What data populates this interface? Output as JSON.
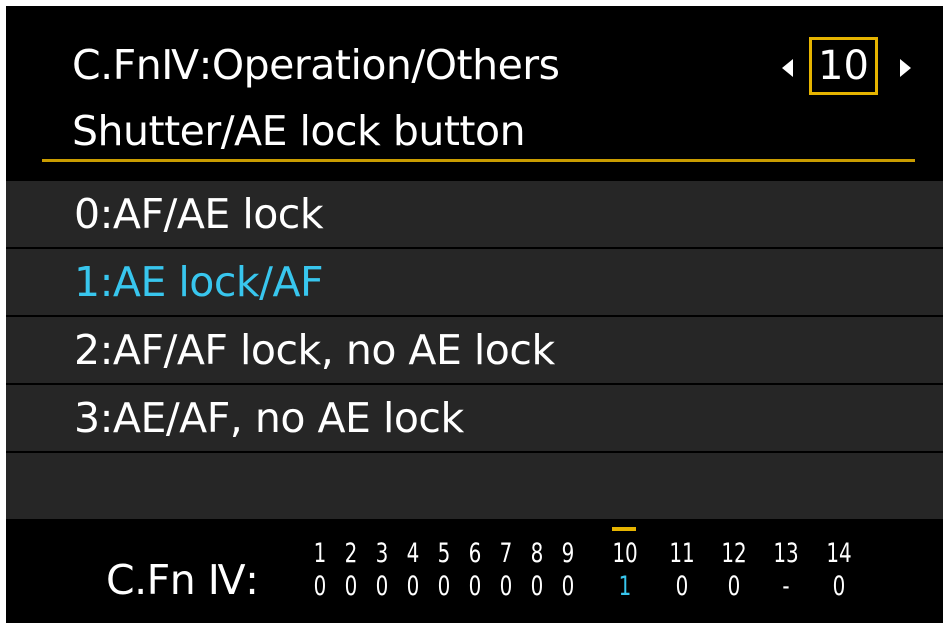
{
  "header": {
    "title": "C.FnⅣ:Operation/Others",
    "subtitle": "Shutter/AE lock button",
    "page_number": "10"
  },
  "options": [
    {
      "label": "0:AF/AE lock",
      "selected": false
    },
    {
      "label": "1:AE lock/AF",
      "selected": true
    },
    {
      "label": "2:AF/AF lock, no AE lock",
      "selected": false
    },
    {
      "label": "3:AE/AF, no AE lock",
      "selected": false
    }
  ],
  "footer": {
    "label": "C.Fn Ⅳ:",
    "functions": [
      {
        "num": "1",
        "val": "0"
      },
      {
        "num": "2",
        "val": "0"
      },
      {
        "num": "3",
        "val": "0"
      },
      {
        "num": "4",
        "val": "0"
      },
      {
        "num": "5",
        "val": "0"
      },
      {
        "num": "6",
        "val": "0"
      },
      {
        "num": "7",
        "val": "0"
      },
      {
        "num": "8",
        "val": "0"
      },
      {
        "num": "9",
        "val": "0"
      },
      {
        "num": "10",
        "val": "1"
      },
      {
        "num": "11",
        "val": "0"
      },
      {
        "num": "12",
        "val": "0"
      },
      {
        "num": "13",
        "val": "-"
      },
      {
        "num": "14",
        "val": "0"
      }
    ],
    "current_index": 9
  },
  "colors": {
    "accent": "#e6b400",
    "selected_text": "#38c6ee",
    "row_bg": "#262626",
    "background": "#000000"
  }
}
